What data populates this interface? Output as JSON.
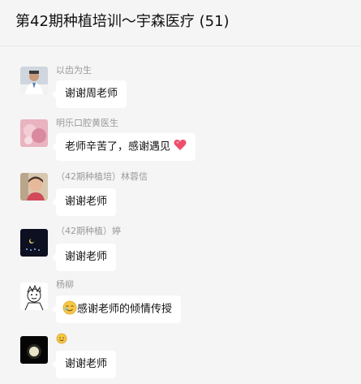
{
  "chat": {
    "title": "第42期种植培训～宇森医疗 (51)"
  },
  "messages": [
    {
      "sender": "以齿为生",
      "text": "谢谢周老师",
      "avatar": "doctor-photo-avatar"
    },
    {
      "sender": "明乐口腔黄医生",
      "text": "老师辛苦了，感谢遇见",
      "avatar": "pink-photo-avatar",
      "trailing_emoji": "heart-emoji"
    },
    {
      "sender": "（42期种植培）林蓉信",
      "text": "谢谢老师",
      "avatar": "child-photo-avatar"
    },
    {
      "sender": "（42期种植）婷",
      "text": "谢谢老师",
      "avatar": "night-moon-avatar"
    },
    {
      "sender": "杨柳",
      "text": "感谢老师的倾情传授",
      "avatar": "cartoon-sketch-avatar",
      "leading_emoji": "tearful-smile-emoji"
    },
    {
      "sender": "",
      "sender_emoji": "smile-emoji",
      "text": "谢谢老师",
      "avatar": "moon-dark-avatar"
    }
  ],
  "colors": {
    "background": "#f5f5f5",
    "bubble": "#ffffff",
    "sender_text": "#9a9a9a",
    "heart": "#ef4e6a"
  }
}
